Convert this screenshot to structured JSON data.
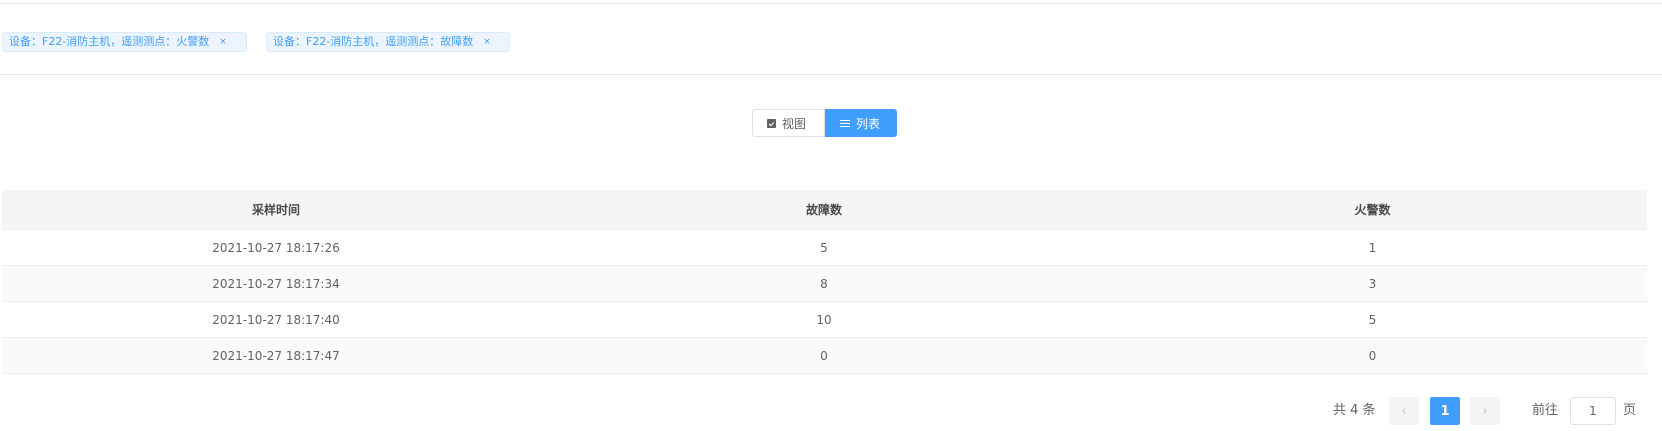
{
  "filters": {
    "tags": [
      {
        "label": "设备：F22-消防主机，遥测测点：火警数",
        "close": "×"
      },
      {
        "label": "设备：F22-消防主机，遥测测点：故障数",
        "close": "×"
      }
    ]
  },
  "view_toggle": {
    "view_label": "视图",
    "list_label": "列表",
    "active": "list"
  },
  "table": {
    "columns": [
      "采样时间",
      "故障数",
      "火警数"
    ],
    "rows": [
      [
        "2021-10-27 18:17:26",
        "5",
        "1"
      ],
      [
        "2021-10-27 18:17:34",
        "8",
        "3"
      ],
      [
        "2021-10-27 18:17:40",
        "10",
        "5"
      ],
      [
        "2021-10-27 18:17:47",
        "0",
        "0"
      ]
    ]
  },
  "pagination": {
    "total_text": "共 4 条",
    "prev_icon": "‹",
    "current_page": "1",
    "next_icon": "›",
    "goto_prefix": "前往",
    "goto_value": "1",
    "goto_suffix": "页"
  },
  "colors": {
    "accent": "#409eff",
    "tag_bg": "#ecf5ff"
  }
}
